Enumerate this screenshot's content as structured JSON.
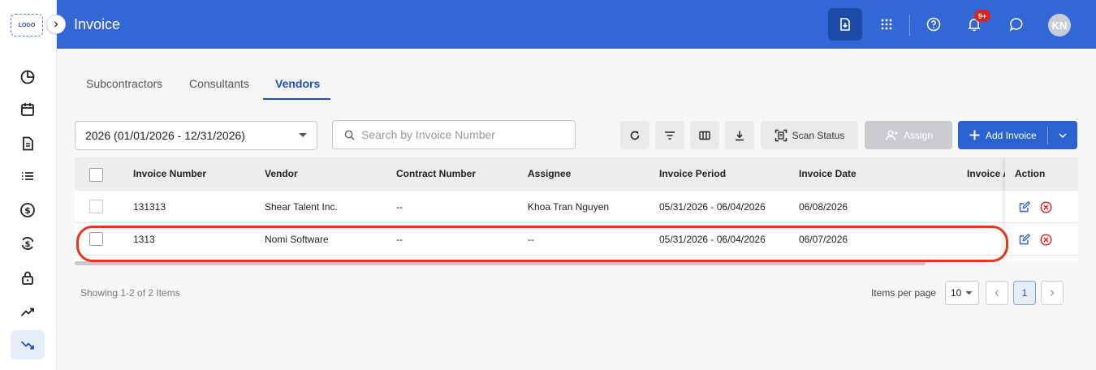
{
  "app": {
    "logo_text": "LOGO",
    "title": "Invoice",
    "notification_count": "9+",
    "user_initials": "KN"
  },
  "colors": {
    "header_bg": "#3467d6",
    "accent": "#1d4fb8",
    "primary_button": "#2b62d1",
    "danger": "#e02020",
    "highlight_ring": "#e8331f"
  },
  "sidebar": {
    "items": [
      {
        "icon": "dashboard-icon"
      },
      {
        "icon": "calendar-icon"
      },
      {
        "icon": "document-icon"
      },
      {
        "icon": "list-icon"
      },
      {
        "icon": "dollar-icon"
      },
      {
        "icon": "dollar-refresh-icon"
      },
      {
        "icon": "lock-icon"
      },
      {
        "icon": "trending-up-icon"
      },
      {
        "icon": "trending-down-icon",
        "active": true
      }
    ]
  },
  "tabs": [
    {
      "label": "Subcontractors"
    },
    {
      "label": "Consultants"
    },
    {
      "label": "Vendors",
      "active": true
    }
  ],
  "toolbar": {
    "period_value": "2026 (01/01/2026 - 12/31/2026)",
    "search_placeholder": "Search by Invoice Number",
    "scan_status_label": "Scan Status",
    "assign_label": "Assign",
    "add_invoice_label": "Add Invoice"
  },
  "table": {
    "columns": [
      "Invoice Number",
      "Vendor",
      "Contract Number",
      "Assignee",
      "Invoice Period",
      "Invoice Date",
      "Invoice A",
      "Action"
    ],
    "rows": [
      {
        "invoice_number": "131313",
        "vendor": "Shear Talent Inc.",
        "contract_number": "--",
        "assignee": "Khoa Tran Nguyen",
        "invoice_period": "05/31/2026 - 06/04/2026",
        "invoice_date": "06/08/2026"
      },
      {
        "invoice_number": "1313",
        "vendor": "Nomi Software",
        "contract_number": "--",
        "assignee": "--",
        "invoice_period": "05/31/2026 - 06/04/2026",
        "invoice_date": "06/07/2026"
      }
    ]
  },
  "footer": {
    "showing_text": "Showing 1-2 of 2 Items",
    "items_per_page_label": "Items per page",
    "items_per_page_value": "10",
    "current_page": "1"
  }
}
